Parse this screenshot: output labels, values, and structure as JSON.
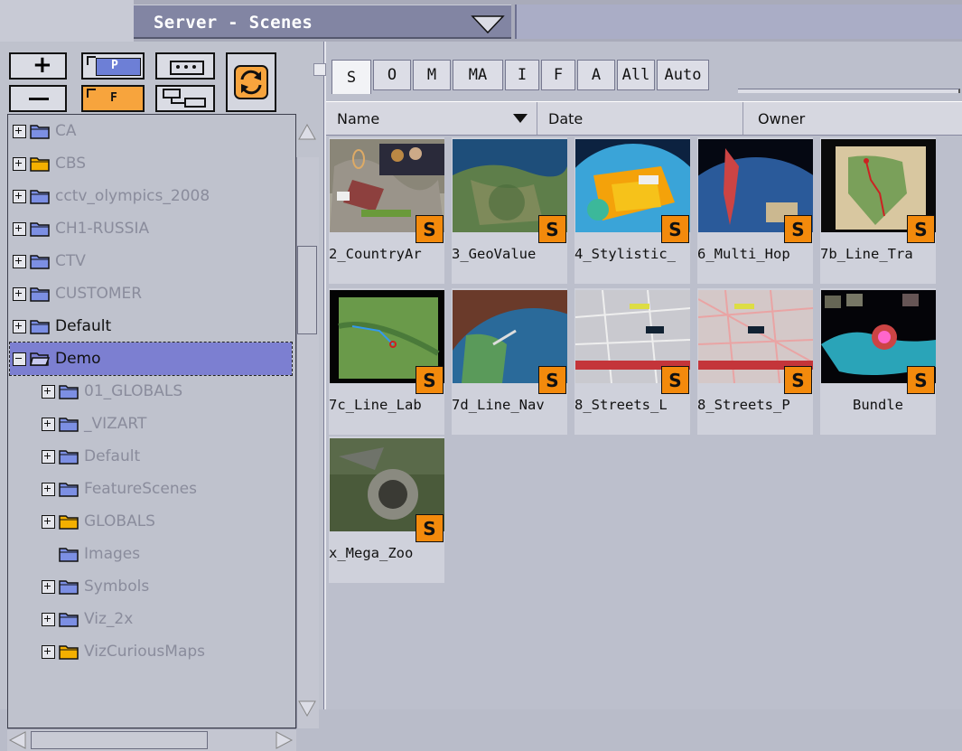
{
  "header": {
    "title": "Server - Scenes"
  },
  "toolbar": {
    "add_label": "+",
    "remove_label": "−",
    "add_project_label": "P",
    "add_folder_label": "F"
  },
  "tree": {
    "items": [
      {
        "label": "CA",
        "indent": 0,
        "folder": "blue",
        "expander": "plus",
        "style": "gray"
      },
      {
        "label": "CBS",
        "indent": 0,
        "folder": "yellow",
        "expander": "plus",
        "style": "gray"
      },
      {
        "label": "cctv_olympics_2008",
        "indent": 0,
        "folder": "blue",
        "expander": "plus",
        "style": "gray"
      },
      {
        "label": "CH1-RUSSIA",
        "indent": 0,
        "folder": "blue",
        "expander": "plus",
        "style": "gray"
      },
      {
        "label": "CTV",
        "indent": 0,
        "folder": "blue",
        "expander": "plus",
        "style": "gray"
      },
      {
        "label": "CUSTOMER",
        "indent": 0,
        "folder": "blue",
        "expander": "plus",
        "style": "gray"
      },
      {
        "label": "Default",
        "indent": 0,
        "folder": "blue",
        "expander": "plus",
        "style": "dark"
      },
      {
        "label": "Demo",
        "indent": 0,
        "folder": "open",
        "expander": "minus",
        "style": "selected"
      },
      {
        "label": "01_GLOBALS",
        "indent": 1,
        "folder": "blue",
        "expander": "plus",
        "style": "gray"
      },
      {
        "label": "_VIZART",
        "indent": 1,
        "folder": "blue",
        "expander": "plus",
        "style": "gray"
      },
      {
        "label": "Default",
        "indent": 1,
        "folder": "blue",
        "expander": "plus",
        "style": "gray"
      },
      {
        "label": "FeatureScenes",
        "indent": 1,
        "folder": "blue",
        "expander": "plus",
        "style": "gray"
      },
      {
        "label": "GLOBALS",
        "indent": 1,
        "folder": "yellow",
        "expander": "plus",
        "style": "gray"
      },
      {
        "label": "Images",
        "indent": 1,
        "folder": "blue",
        "expander": "none",
        "style": "gray"
      },
      {
        "label": "Symbols",
        "indent": 1,
        "folder": "blue",
        "expander": "plus",
        "style": "gray"
      },
      {
        "label": "Viz_2x",
        "indent": 1,
        "folder": "blue",
        "expander": "plus",
        "style": "gray"
      },
      {
        "label": "VizCuriousMaps",
        "indent": 1,
        "folder": "yellow",
        "expander": "plus",
        "style": "gray"
      }
    ]
  },
  "tabs": [
    "S",
    "O",
    "M",
    "MA",
    "I",
    "F",
    "A",
    "All",
    "Auto"
  ],
  "columns": {
    "name": "Name",
    "date": "Date",
    "owner": "Owner"
  },
  "scenes": [
    {
      "name": "2_CountryAr",
      "badge": "S",
      "theme": "country"
    },
    {
      "name": "3_GeoValue",
      "badge": "S",
      "theme": "geo"
    },
    {
      "name": "4_Stylistic_",
      "badge": "S",
      "theme": "stylistic"
    },
    {
      "name": "6_Multi_Hop",
      "badge": "S",
      "theme": "multihop"
    },
    {
      "name": "7b_Line_Tra",
      "badge": "S",
      "theme": "linetra"
    },
    {
      "name": "7c_Line_Lab",
      "badge": "S",
      "theme": "linelab"
    },
    {
      "name": "7d_Line_Nav",
      "badge": "S",
      "theme": "linenav"
    },
    {
      "name": "8_Streets_L",
      "badge": "S",
      "theme": "streets"
    },
    {
      "name": "8_Streets_P",
      "badge": "S",
      "theme": "streetsp"
    },
    {
      "name": "Bundle",
      "badge": "S",
      "theme": "bundle"
    },
    {
      "name": "x_Mega_Zoo",
      "badge": "S",
      "theme": "megazoo"
    }
  ],
  "colors": {
    "accent_orange": "#f38a0c",
    "selection": "#7c7fd1",
    "title_bg": "#8285a3"
  }
}
